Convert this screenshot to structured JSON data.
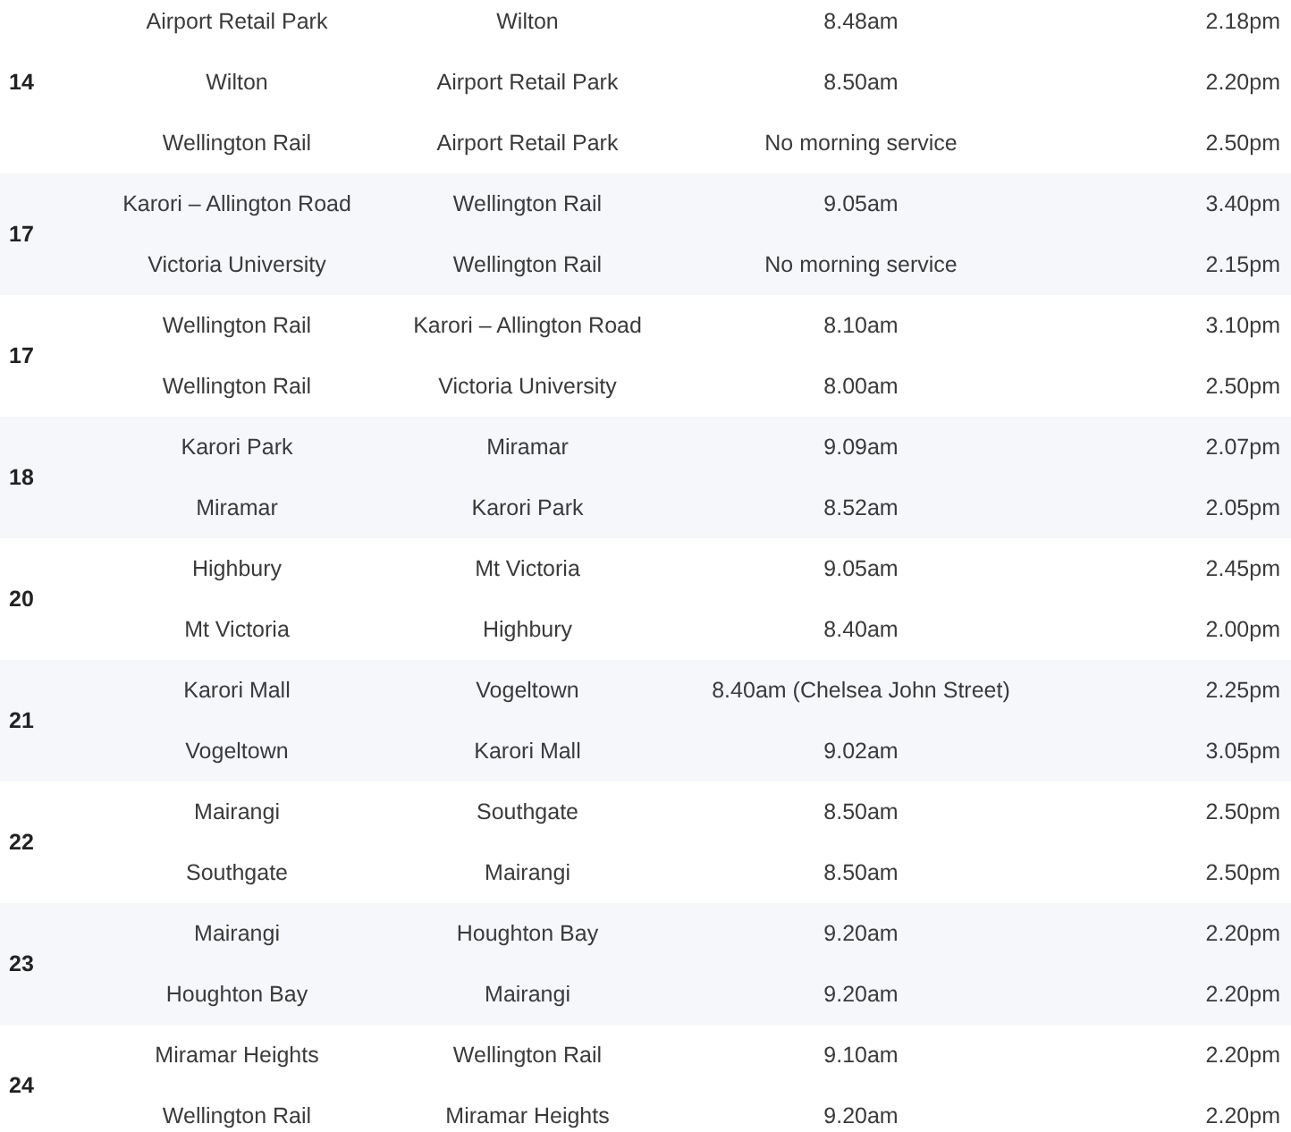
{
  "routes": [
    {
      "route": "14",
      "trips": [
        [
          "Airport Retail Park",
          "Wilton",
          "8.48am",
          "2.18pm"
        ],
        [
          "Wilton",
          "Airport Retail Park",
          "8.50am",
          "2.20pm"
        ],
        [
          "Wellington Rail",
          "Airport Retail Park",
          "No morning service",
          "2.50pm"
        ]
      ]
    },
    {
      "route": "17",
      "trips": [
        [
          "Karori – Allington Road",
          "Wellington Rail",
          "9.05am",
          "3.40pm"
        ],
        [
          "Victoria University",
          "Wellington Rail",
          "No morning service",
          "2.15pm"
        ]
      ]
    },
    {
      "route": "17",
      "trips": [
        [
          "Wellington Rail",
          "Karori – Allington Road",
          "8.10am",
          "3.10pm"
        ],
        [
          "Wellington Rail",
          "Victoria University",
          "8.00am",
          "2.50pm"
        ]
      ]
    },
    {
      "route": "18",
      "trips": [
        [
          "Karori Park",
          "Miramar",
          "9.09am",
          "2.07pm"
        ],
        [
          "Miramar",
          "Karori Park",
          "8.52am",
          "2.05pm"
        ]
      ]
    },
    {
      "route": "20",
      "trips": [
        [
          "Highbury",
          "Mt Victoria",
          "9.05am",
          "2.45pm"
        ],
        [
          "Mt Victoria",
          "Highbury",
          "8.40am",
          "2.00pm"
        ]
      ]
    },
    {
      "route": "21",
      "trips": [
        [
          "Karori Mall",
          "Vogeltown",
          "8.40am (Chelsea John Street)",
          "2.25pm"
        ],
        [
          "Vogeltown",
          "Karori Mall",
          "9.02am",
          "3.05pm"
        ]
      ]
    },
    {
      "route": "22",
      "trips": [
        [
          "Mairangi",
          "Southgate",
          "8.50am",
          "2.50pm"
        ],
        [
          "Southgate",
          "Mairangi",
          "8.50am",
          "2.50pm"
        ]
      ]
    },
    {
      "route": "23",
      "trips": [
        [
          "Mairangi",
          "Houghton Bay",
          "9.20am",
          "2.20pm"
        ],
        [
          "Houghton Bay",
          "Mairangi",
          "9.20am",
          "2.20pm"
        ]
      ]
    },
    {
      "route": "24",
      "trips": [
        [
          "Miramar Heights",
          "Wellington Rail",
          "9.10am",
          "2.20pm"
        ],
        [
          "Wellington Rail",
          "Miramar Heights",
          "9.20am",
          "2.20pm"
        ]
      ]
    }
  ]
}
